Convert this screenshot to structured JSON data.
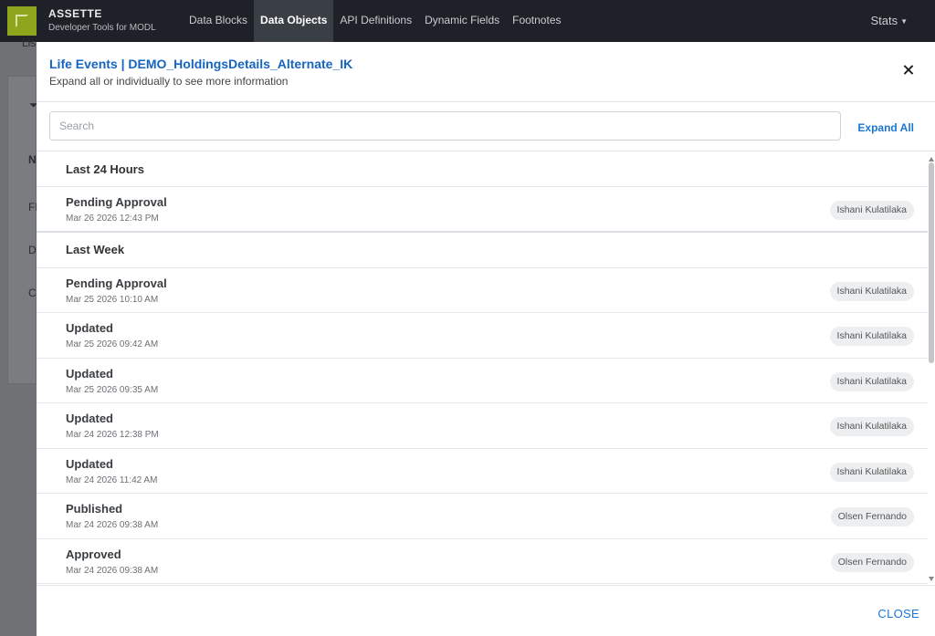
{
  "navbar": {
    "brand_name": "ASSETTE",
    "brand_sub": "Developer Tools for MODL",
    "links": [
      "Data Blocks",
      "Data Objects",
      "API Definitions",
      "Dynamic Fields",
      "Footnotes"
    ],
    "active_link": "Data Objects",
    "stats_label": "Stats"
  },
  "background": {
    "fragments": [
      "Lis",
      "N",
      "Fl",
      "D",
      "C"
    ]
  },
  "modal": {
    "title": "Life Events | DEMO_HoldingsDetails_Alternate_IK",
    "subtitle": "Expand all or individually to see more information",
    "search_placeholder": "Search",
    "search_value": "",
    "expand_all_label": "Expand All",
    "close_label": "CLOSE",
    "groups": [
      {
        "label": "Last 24 Hours",
        "events": [
          {
            "title": "Pending Approval",
            "date": "Mar 26 2026 12:43 PM",
            "user": "Ishani Kulatilaka"
          }
        ]
      },
      {
        "label": "Last Week",
        "events": [
          {
            "title": "Pending Approval",
            "date": "Mar 25 2026 10:10 AM",
            "user": "Ishani Kulatilaka"
          },
          {
            "title": "Updated",
            "date": "Mar 25 2026 09:42 AM",
            "user": "Ishani Kulatilaka"
          },
          {
            "title": "Updated",
            "date": "Mar 25 2026 09:35 AM",
            "user": "Ishani Kulatilaka"
          },
          {
            "title": "Updated",
            "date": "Mar 24 2026 12:38 PM",
            "user": "Ishani Kulatilaka"
          },
          {
            "title": "Updated",
            "date": "Mar 24 2026 11:42 AM",
            "user": "Ishani Kulatilaka"
          },
          {
            "title": "Published",
            "date": "Mar 24 2026 09:38 AM",
            "user": "Olsen Fernando"
          },
          {
            "title": "Approved",
            "date": "Mar 24 2026 09:38 AM",
            "user": "Olsen Fernando"
          }
        ]
      }
    ]
  },
  "colors": {
    "navbar_bg": "#1e2228",
    "logo_green": "#8fa51b",
    "title_blue": "#1565c0",
    "link_blue": "#1976d2",
    "overlay_gray": "#6f7174"
  }
}
